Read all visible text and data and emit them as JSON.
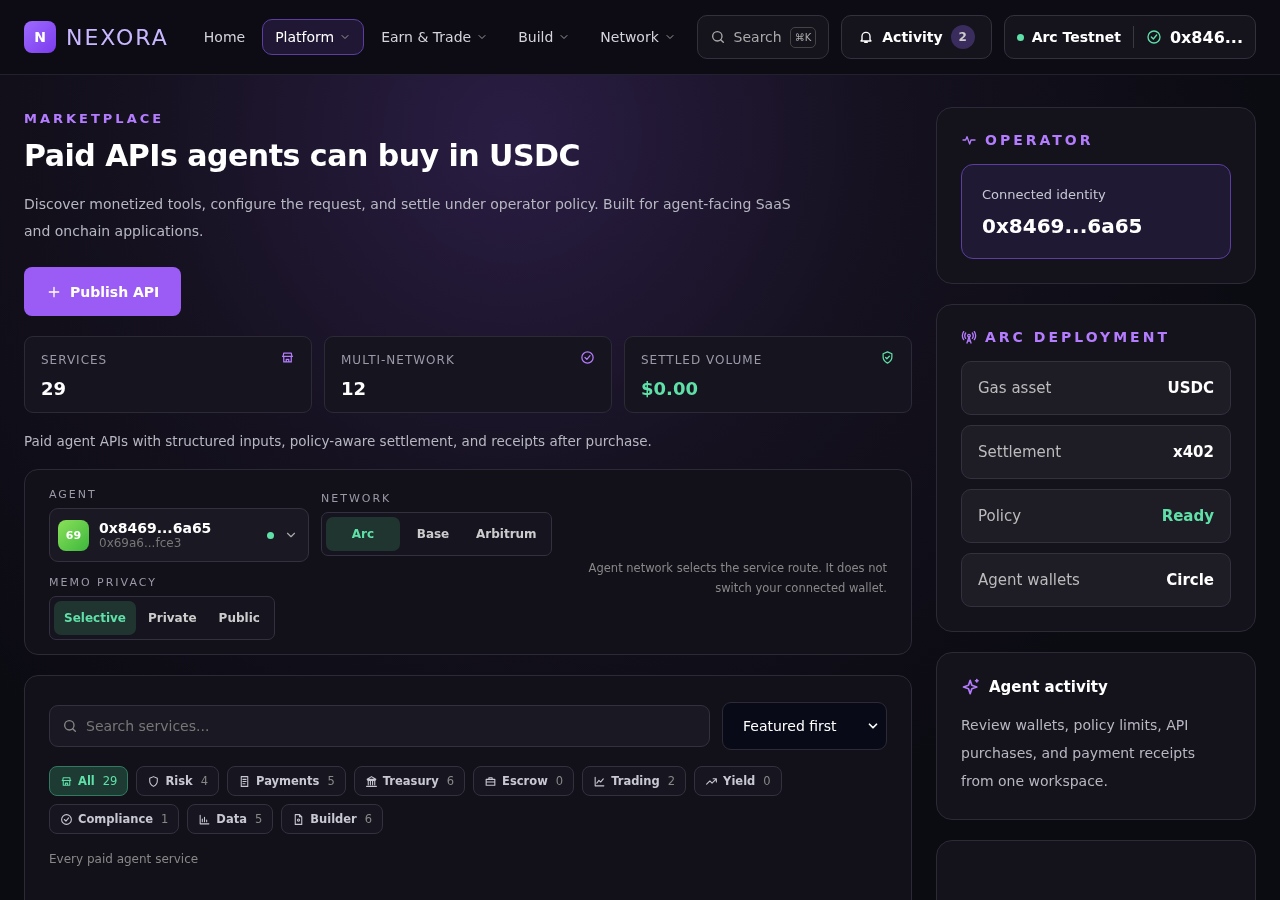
{
  "header": {
    "logo_badge": "N",
    "logo_text": "NEXORA",
    "nav": [
      {
        "label": "Home",
        "selected": false,
        "dropdown": false
      },
      {
        "label": "Platform",
        "selected": true,
        "dropdown": true
      },
      {
        "label": "Earn & Trade",
        "selected": false,
        "dropdown": true
      },
      {
        "label": "Build",
        "selected": false,
        "dropdown": true
      },
      {
        "label": "Network",
        "selected": false,
        "dropdown": true
      }
    ],
    "search": {
      "label": "Search",
      "shortcut": "⌘K"
    },
    "activity": {
      "label": "Activity",
      "count": "2"
    },
    "wallet": {
      "network": "Arc Testnet",
      "address": "0x846..."
    }
  },
  "hero": {
    "eyebrow": "MARKETPLACE",
    "title": "Paid APIs agents can buy in USDC",
    "description": "Discover monetized tools, configure the request, and settle under operator policy. Built for agent-facing SaaS and onchain applications.",
    "button": "Publish API"
  },
  "stats": [
    {
      "label": "SERVICES",
      "value": "29",
      "accent": false
    },
    {
      "label": "MULTI-NETWORK",
      "value": "12",
      "accent": false
    },
    {
      "label": "SETTLED VOLUME",
      "value": "$0.00",
      "accent": true
    }
  ],
  "stats_note": "Paid agent APIs with structured inputs, policy-aware settlement, and receipts after purchase.",
  "config": {
    "agent_label": "AGENT",
    "agent": {
      "avatar": "69",
      "name": "0x8469...6a65",
      "sub": "0x69a6...fce3",
      "online": true
    },
    "network_label": "NETWORK",
    "networks": [
      {
        "label": "Arc",
        "selected": true
      },
      {
        "label": "Base",
        "selected": false
      },
      {
        "label": "Arbitrum",
        "selected": false
      }
    ],
    "network_note": "Agent network selects the service route. It does not switch your connected wallet.",
    "memo_label": "MEMO PRIVACY",
    "memo": [
      {
        "label": "Selective",
        "selected": true
      },
      {
        "label": "Private",
        "selected": false
      },
      {
        "label": "Public",
        "selected": false
      }
    ]
  },
  "catalog": {
    "search_placeholder": "Search services...",
    "sort": "Featured first",
    "categories": [
      {
        "label": "All",
        "count": "29",
        "selected": true
      },
      {
        "label": "Risk",
        "count": "4",
        "selected": false
      },
      {
        "label": "Payments",
        "count": "5",
        "selected": false
      },
      {
        "label": "Treasury",
        "count": "6",
        "selected": false
      },
      {
        "label": "Escrow",
        "count": "0",
        "selected": false
      },
      {
        "label": "Trading",
        "count": "2",
        "selected": false
      },
      {
        "label": "Yield",
        "count": "0",
        "selected": false
      },
      {
        "label": "Compliance",
        "count": "1",
        "selected": false
      },
      {
        "label": "Data",
        "count": "5",
        "selected": false
      },
      {
        "label": "Builder",
        "count": "6",
        "selected": false
      }
    ],
    "note": "Every paid agent service"
  },
  "sidebar": {
    "operator": {
      "title": "OPERATOR",
      "identity_label": "Connected identity",
      "identity": "0x8469...6a65"
    },
    "deployment": {
      "title": "ARC DEPLOYMENT",
      "rows": [
        {
          "label": "Gas asset",
          "value": "USDC",
          "status": false
        },
        {
          "label": "Settlement",
          "value": "x402",
          "status": false
        },
        {
          "label": "Policy",
          "value": "Ready",
          "status": true
        },
        {
          "label": "Agent wallets",
          "value": "Circle",
          "status": false
        }
      ]
    },
    "activity": {
      "title": "Agent activity",
      "text": "Review wallets, policy limits, API purchases, and payment receipts from one workspace."
    }
  }
}
